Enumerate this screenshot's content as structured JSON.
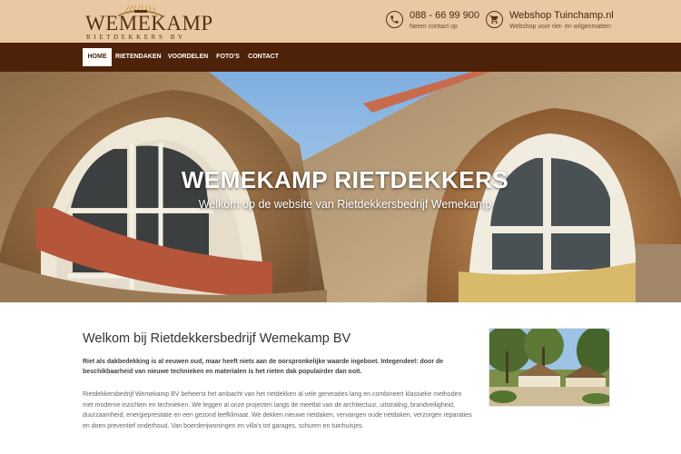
{
  "header": {
    "logo": {
      "name": "WEMEKAMP",
      "subtitle": "RIETDEKKERS BV",
      "mark_icon": "thatch-bundle-icon"
    },
    "phone": {
      "icon": "phone-icon",
      "number": "088 - 66 99 900",
      "caption": "Neem contact op"
    },
    "webshop": {
      "icon": "cart-icon",
      "label": "Webshop Tuinchamp.nl",
      "caption": "Webshop voor riet- en wilgenmatten"
    }
  },
  "nav": {
    "items": [
      {
        "label": "HOME",
        "active": true
      },
      {
        "label": "RIETENDAKEN",
        "active": false
      },
      {
        "label": "VOORDELEN",
        "active": false
      },
      {
        "label": "FOTO'S",
        "active": false
      },
      {
        "label": "CONTACT",
        "active": false
      }
    ]
  },
  "hero": {
    "title": "WEMEKAMP RIETDEKKERS",
    "subtitle": "Welkom op de website van Rietdekkersbedrijf Wemekamp"
  },
  "main": {
    "title": "Welkom bij Rietdekkersbedrijf Wemekamp BV",
    "intro": "Riet als dakbedekking is al eeuwen oud, maar heeft niets aan de oorspronkelijke waarde ingeboet. Integendeel: door de beschikbaarheid van nieuwe technieken en materialen is het rieten dak populairder dan ooit.",
    "body": "Rietdekkersbedrijf Wemekamp BV beheerst het ambacht van het rietdekken al vele generaties lang en combineert klassieke methoden met moderne inzichten en technieken. We leggen al onze projecten langs de meetlat van de architectuur, uitstraling, brandveiligheid, duurzaamheid, energieprestatie en een gezond leefklimaat. We dekken nieuwe rietdaken, vervangen oude rietdaken, verzorgen reparaties en doen preventief onderhoud. Van boerderijwoningen en villa's tot garages, schuren en tuinhuisjes."
  },
  "colors": {
    "topbar": "#e8c9a3",
    "nav": "#4e2209",
    "brand": "#5b2f12"
  }
}
